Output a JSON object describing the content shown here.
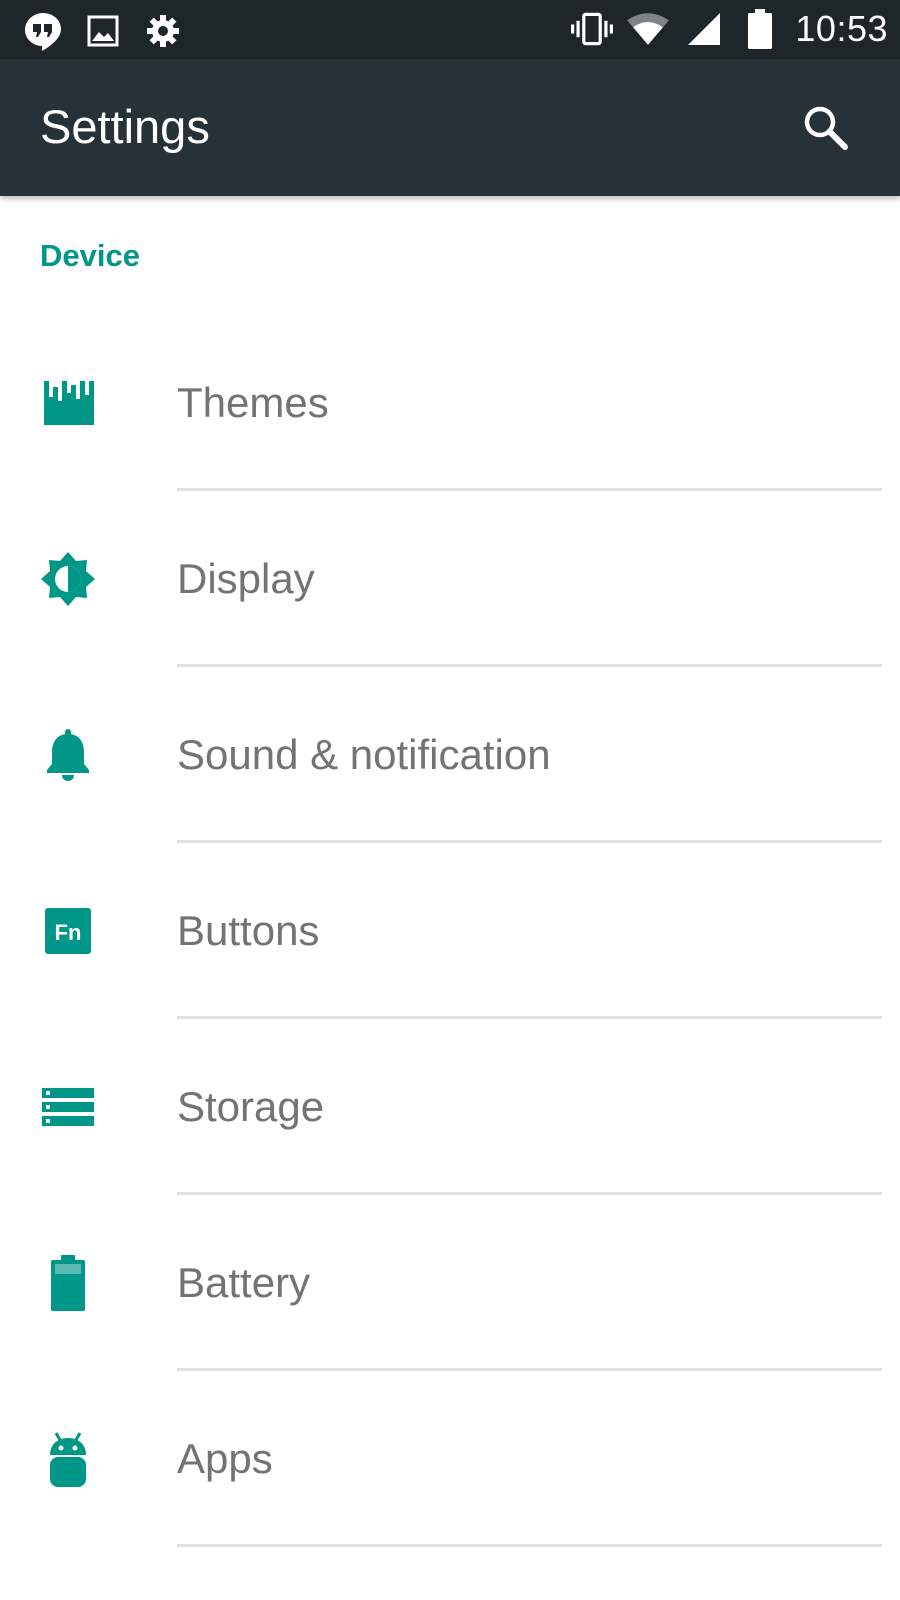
{
  "status_bar": {
    "left_icons": [
      "hangouts-icon",
      "image-icon",
      "gear-icon"
    ],
    "right_icons": [
      "vibrate-icon",
      "wifi-icon",
      "cell-signal-icon",
      "battery-full-icon"
    ],
    "time": "10:53"
  },
  "app_bar": {
    "title": "Settings",
    "search_icon": "search-icon"
  },
  "section": {
    "header": "Device"
  },
  "colors": {
    "accent": "#009688",
    "app_bar": "#263238",
    "status_bar": "#1e262a",
    "label": "#737373",
    "divider": "#e2e2e2"
  },
  "items": [
    {
      "label": "Themes",
      "icon": "themes-icon"
    },
    {
      "label": "Display",
      "icon": "brightness-icon"
    },
    {
      "label": "Sound & notification",
      "icon": "bell-icon"
    },
    {
      "label": "Buttons",
      "icon": "fn-key-icon",
      "icon_text": "Fn"
    },
    {
      "label": "Storage",
      "icon": "storage-icon"
    },
    {
      "label": "Battery",
      "icon": "battery-icon"
    },
    {
      "label": "Apps",
      "icon": "android-icon"
    }
  ]
}
